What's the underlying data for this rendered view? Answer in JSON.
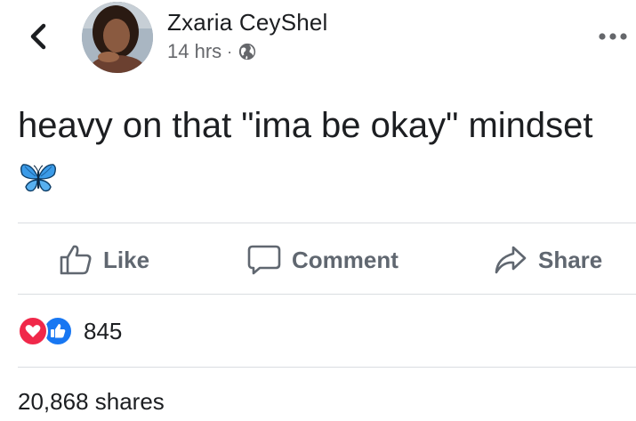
{
  "post": {
    "author": "Zxaria CeyShel",
    "time": "14 hrs",
    "separator": "·",
    "text": "heavy on that \"ima be okay\" mindset",
    "emoji": "butterfly"
  },
  "actions": {
    "like": "Like",
    "comment": "Comment",
    "share": "Share"
  },
  "stats": {
    "reaction_count": "845",
    "shares": "20,868 shares"
  },
  "icons": {
    "back": "chevron-left-icon",
    "more": "ellipsis-icon",
    "privacy": "globe-icon",
    "like": "thumbs-up-icon",
    "comment": "speech-bubble-icon",
    "share": "share-arrow-icon",
    "love_reaction": "heart-icon",
    "like_reaction": "thumbs-up-icon"
  },
  "colors": {
    "text": "#1c1e21",
    "secondary_text": "#65676b",
    "action_text": "#606770",
    "divider": "#dadde1",
    "love": "#f0284a",
    "like": "#1877f2",
    "butterfly": "#3b9be8"
  }
}
